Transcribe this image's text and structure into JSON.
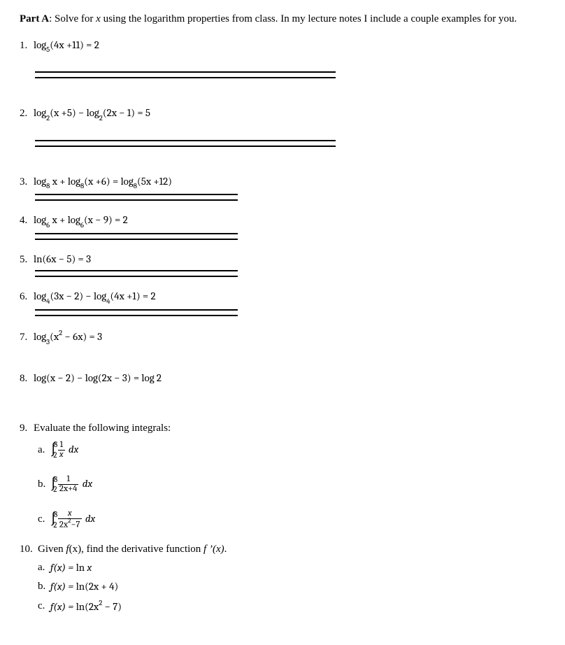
{
  "intro": {
    "part_label": "Part A",
    "part_text": ": Solve for ",
    "var": "x",
    "tail": " using the logarithm properties from class. In my lecture notes I include a couple examples for you."
  },
  "p1": {
    "n": "1. ",
    "fn": "log",
    "base": "5",
    "arg": "(4x +11) = 2"
  },
  "p2": {
    "n": "2. ",
    "fn1": "log",
    "b1": "2",
    "a1": "(x +5) − ",
    "fn2": "log",
    "b2": "2",
    "a2": "(2x − 1) = 5"
  },
  "p3": {
    "n": "3. ",
    "fn1": "log",
    "b1": "8",
    "a1": " x + ",
    "fn2": "log",
    "b2": "8",
    "a2": "(x +6) = ",
    "fn3": "log",
    "b3": "8",
    "a3": "(5x +12)"
  },
  "p4": {
    "n": "4. ",
    "fn1": "log",
    "b1": "6",
    "a1": " x + ",
    "fn2": "log",
    "b2": "6",
    "a2": "(x − 9) = 2"
  },
  "p5": {
    "n": "5. ",
    "expr": "ln(6x − 5) = 3"
  },
  "p6": {
    "n": "6. ",
    "fn1": "log",
    "b1": "4",
    "a1": "(3x − 2) − ",
    "fn2": "log",
    "b2": "4",
    "a2": "(4x +1) = 2"
  },
  "p7": {
    "n": "7. ",
    "fn": "log",
    "b": "3",
    "arg_open": "(x",
    "exp": "2",
    "arg_rest": " − 6x) = 3"
  },
  "p8": {
    "n": "8. ",
    "expr": "log(x − 2) − log(2x − 3) = log 2"
  },
  "p9": {
    "n": "9. ",
    "prompt": "Evaluate the following integrals:",
    "a": {
      "l": "a. ",
      "int_lo": "2",
      "int_hi": "8",
      "top": "1",
      "bot_x": "x",
      "dx": "dx"
    },
    "b": {
      "l": "b. ",
      "int_lo": "2",
      "int_hi": "8",
      "top": "1",
      "bot": "2x+4",
      "dx": "dx"
    },
    "c": {
      "l": "c. ",
      "int_lo": "2",
      "int_hi": "8",
      "top_x": "x",
      "bot_pre": "2x",
      "bot_exp": "2",
      "bot_post": "−7",
      "dx": "dx"
    }
  },
  "p10": {
    "n": "10. ",
    "prompt_pre": "Given ",
    "prompt_fx": "f",
    "prompt_px": "(x)",
    "prompt_mid": ", find the derivative function ",
    "prompt_fpx": "f ’(x)",
    "prompt_end": ".",
    "a": {
      "l": "a. ",
      "lhs": "f(x) = ",
      "rhs_pre": "ln ",
      "rhs_x": "x"
    },
    "b": {
      "l": "b. ",
      "lhs": "f(x) = ",
      "rhs": "ln(2x + 4)"
    },
    "c": {
      "l": "c. ",
      "lhs": "f(x) = ",
      "rhs_pre": "ln(2x",
      "rhs_exp": "2",
      "rhs_post": " − 7)"
    }
  }
}
